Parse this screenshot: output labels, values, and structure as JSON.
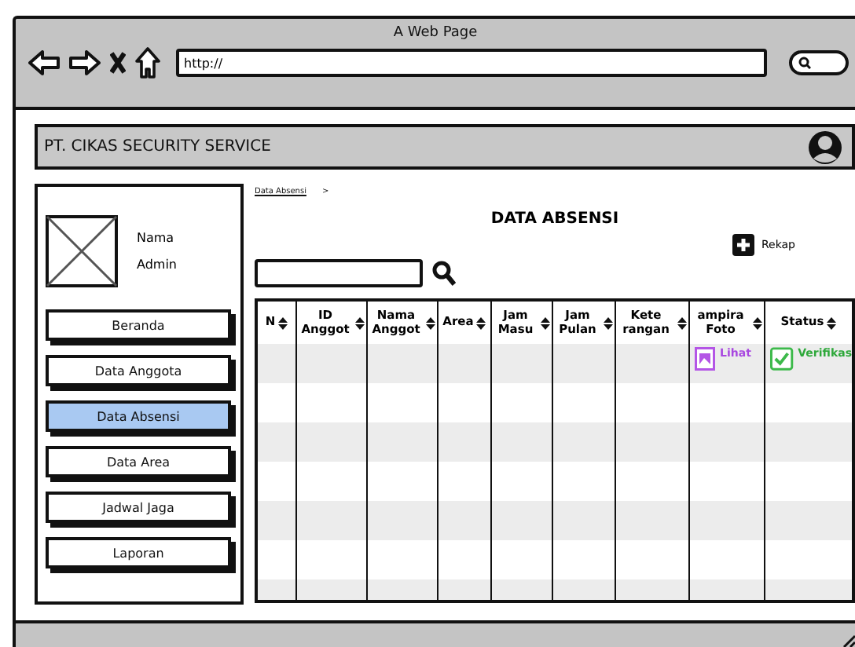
{
  "window": {
    "title": "A Web Page"
  },
  "browser": {
    "address": "http://"
  },
  "header": {
    "title": "PT. CIKAS SECURITY SERVICE"
  },
  "profile": {
    "name": "Nama",
    "role": "Admin"
  },
  "sidebar": {
    "items": [
      {
        "label": "Beranda",
        "selected": false
      },
      {
        "label": "Data Anggota",
        "selected": false
      },
      {
        "label": "Data Absensi",
        "selected": true
      },
      {
        "label": "Data Area",
        "selected": false
      },
      {
        "label": "Jadwal Jaga",
        "selected": false
      },
      {
        "label": "Laporan",
        "selected": false
      }
    ]
  },
  "breadcrumb": {
    "link": "Data Absensi",
    "separator": ">"
  },
  "page_title": "DATA ABSENSI",
  "rekap_button": "Rekap",
  "table": {
    "columns": [
      "N",
      "ID Anggot",
      "Nama Anggot",
      "Area",
      "Jam Masu",
      "Jam Pulan",
      "Kete rangan",
      "ampira Foto",
      "Status"
    ],
    "rows": [
      {
        "photo_link": "Lihat",
        "status": "Verifikas",
        "verified": true
      }
    ]
  }
}
